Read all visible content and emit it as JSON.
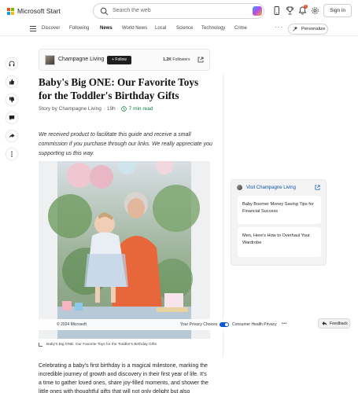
{
  "header": {
    "brand": "Microsoft Start",
    "search_placeholder": "Search the web",
    "notification_count": "1",
    "signin_label": "Sign in"
  },
  "nav": {
    "items": [
      "Discover",
      "Following",
      "News",
      "World News",
      "Local",
      "Science",
      "Technology",
      "Crime"
    ],
    "active": "News",
    "more": "···",
    "personalize_label": "Personalize"
  },
  "publisher": {
    "name": "Champagne Living",
    "follow_label": "+ Follow",
    "followers_count": "1.2K",
    "followers_label": "Followers"
  },
  "article": {
    "title": "Baby's Big ONE: Our Favorite Toys for the Toddler's Birthday Gifts",
    "byline_prefix": "Story by Champagne Living",
    "byline_time": "· 19h ·",
    "read_time": "7 min read",
    "disclaimer": "We received product to facilitate this guide and receive a small commission if you purchase through our links. We really appreciate you supporting us this way.",
    "image_caption": "Baby's Big ONE: Our Favorite Toys for the Toddler's Birthday Gifts",
    "body": "Celebrating a baby's first birthday is a magical milestone, marking the incredible journey of growth and discovery in their first year of life. It's a time to gather loved ones, share joy-filled moments, and shower the little ones with thoughtful gifts that will not only delight but also"
  },
  "sidebar_card": {
    "header": "Visit Champagne Living",
    "items": [
      "Baby Boomer Money Saving Tips for Financial Success",
      "Men, Here's How to Overhaul Your Wardrobe"
    ]
  },
  "footer": {
    "copyright": "© 2024 Microsoft",
    "privacy_choices": "Your Privacy Choices",
    "consumer_health": "Consumer Health Privacy",
    "more": "•••",
    "feedback_label": "Feedback"
  },
  "colors": {
    "accent_blue": "#0b57a6",
    "read_time_green": "#0f7b3e",
    "badge_red": "#e74c1c"
  }
}
